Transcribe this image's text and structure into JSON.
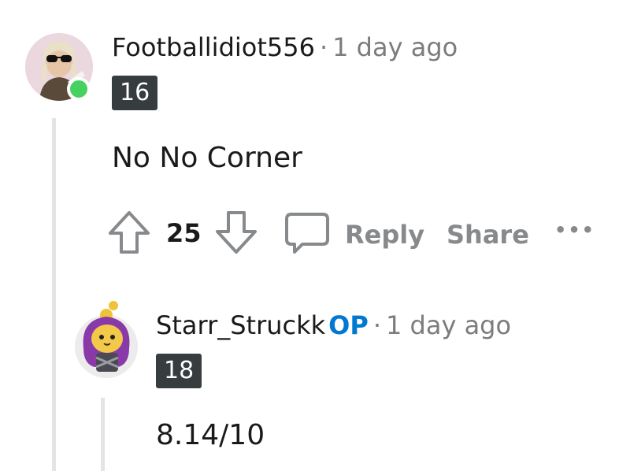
{
  "comments": [
    {
      "username": "Footballidiot556",
      "time": "1 day ago",
      "flair": "16",
      "body": "No No Corner",
      "votes": "25",
      "online": true
    },
    {
      "username": "Starr_Struckk",
      "op_badge": "OP",
      "time": "1 day ago",
      "flair": "18",
      "body": "8.14/10"
    }
  ],
  "actions": {
    "reply_label": "Reply",
    "share_label": "Share",
    "more_label": "•••"
  },
  "separator": "·",
  "icons": [
    "upvote-icon",
    "downvote-icon",
    "comment-bubble-icon",
    "more-icon"
  ],
  "colors": {
    "accent_op": "#0079d3",
    "online": "#46d160",
    "flair_bg": "#373c3f",
    "muted": "#878a8c"
  }
}
